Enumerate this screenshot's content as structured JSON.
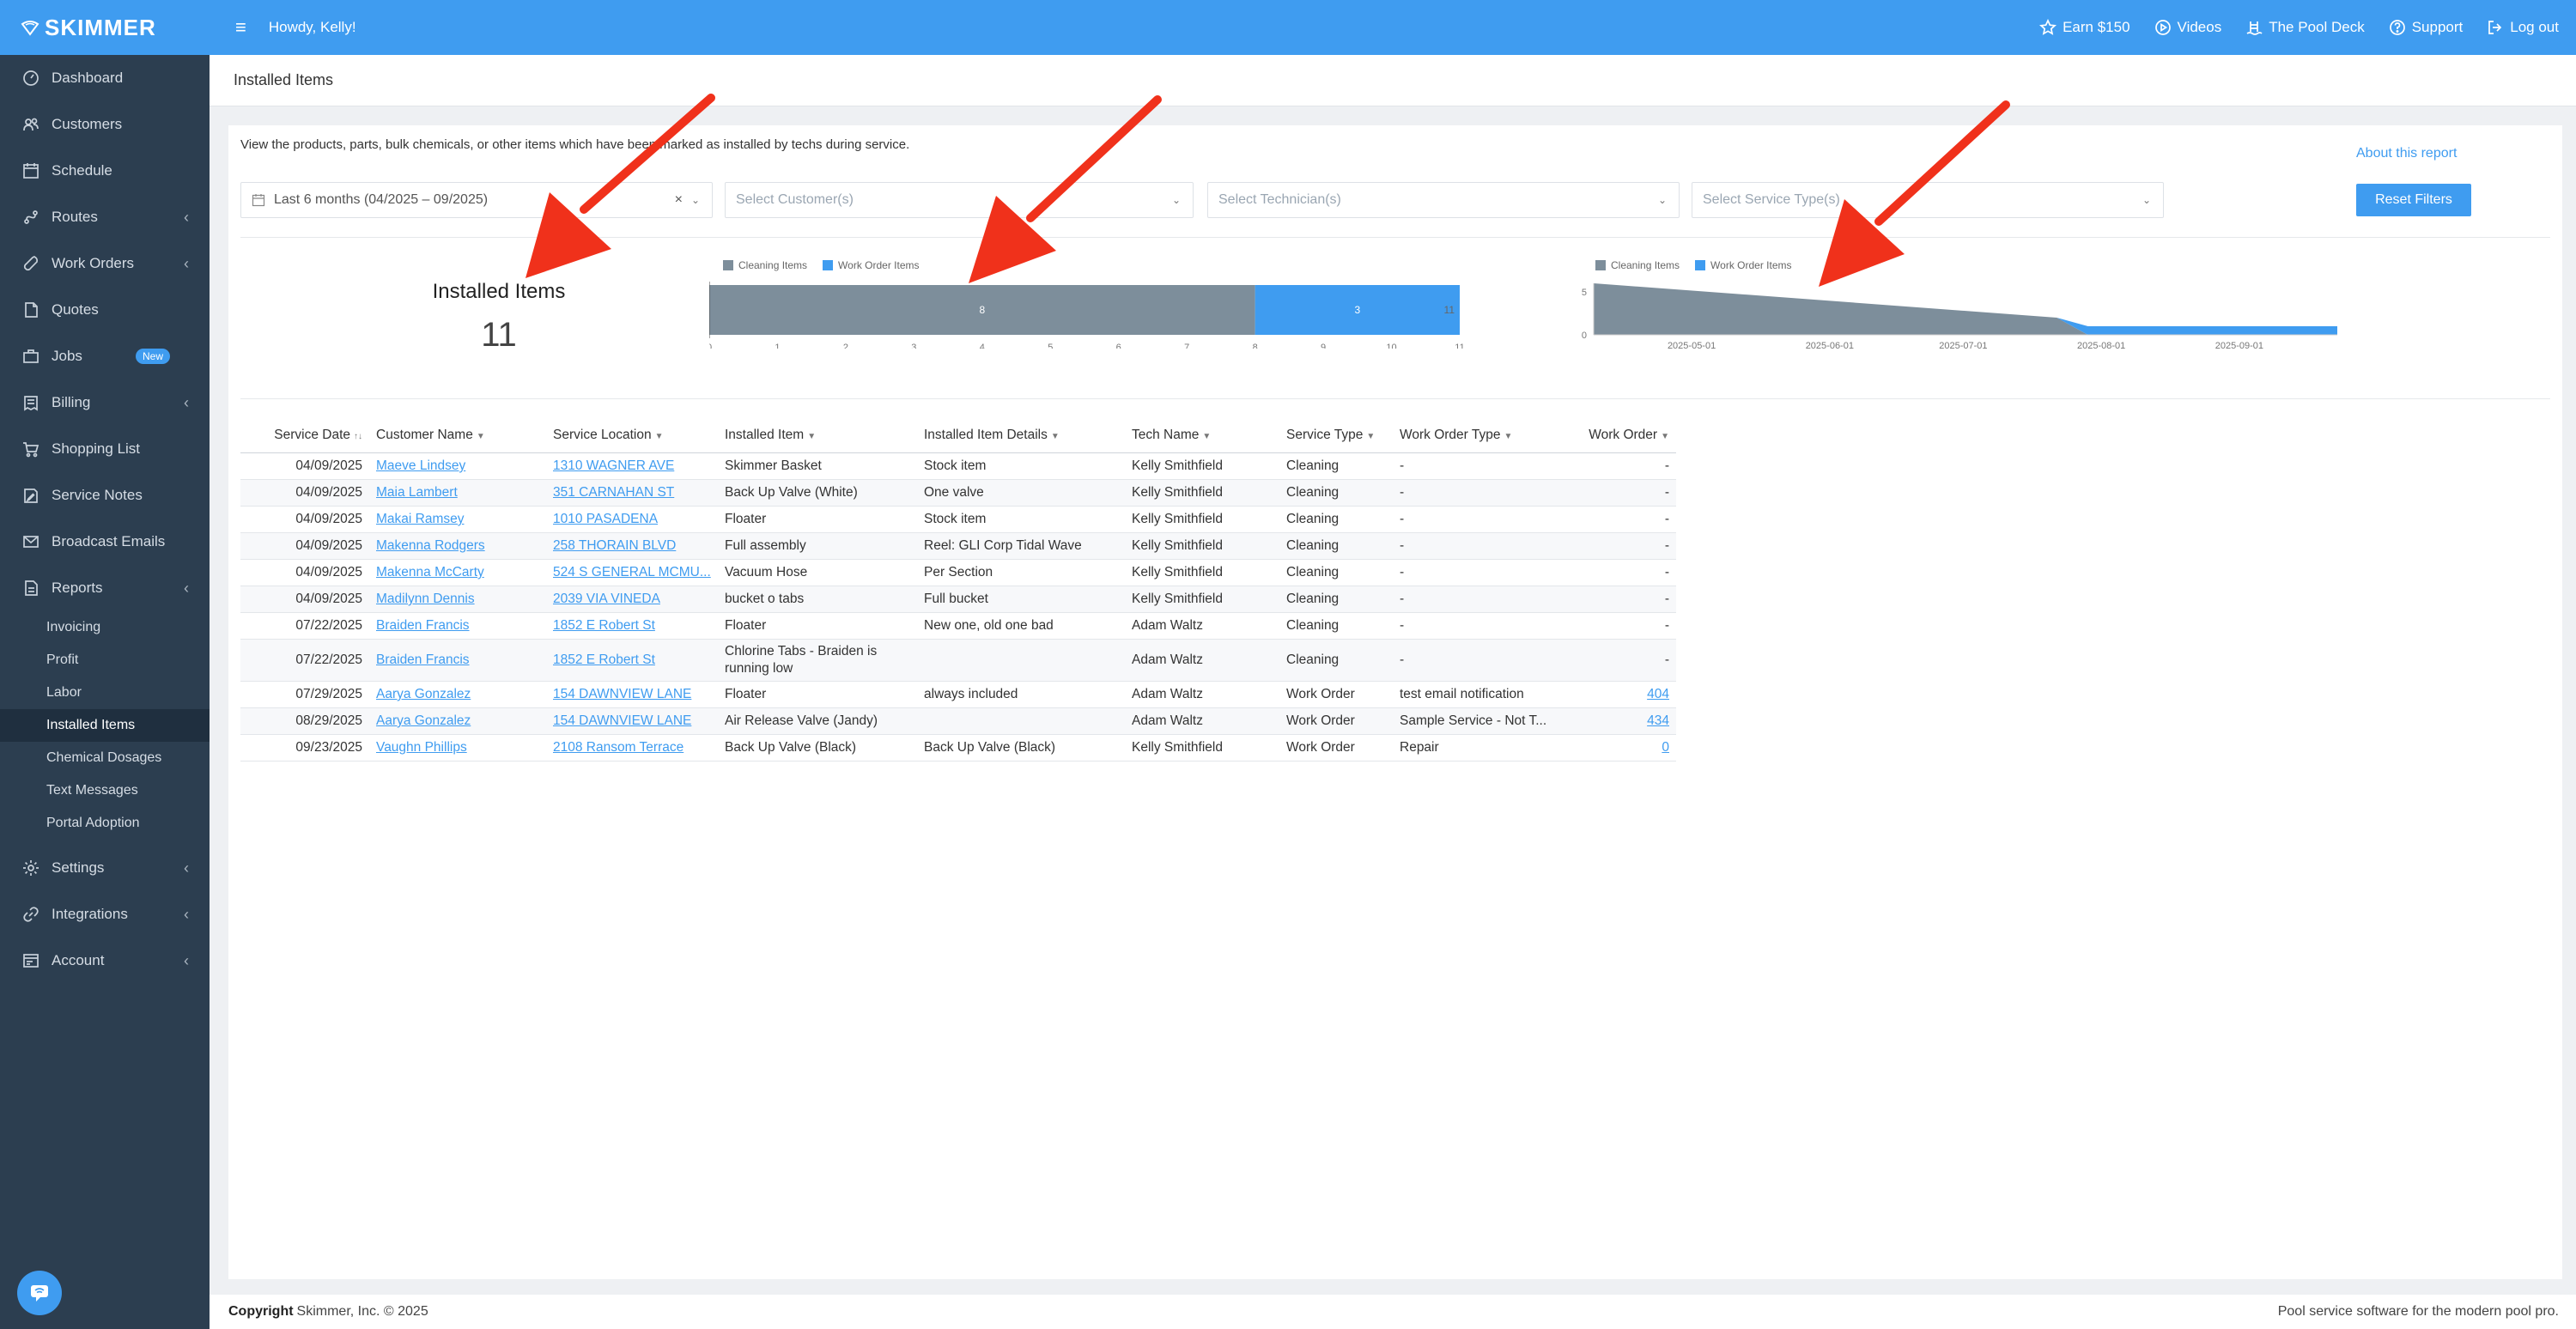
{
  "app": {
    "logo": "SKIMMER"
  },
  "topbar": {
    "greeting": "Howdy, Kelly!",
    "links": [
      "Earn $150",
      "Videos",
      "The Pool Deck",
      "Support",
      "Log out"
    ]
  },
  "sidebar": {
    "items": [
      {
        "label": "Dashboard",
        "icon": "dashboard-icon"
      },
      {
        "label": "Customers",
        "icon": "customers-icon"
      },
      {
        "label": "Schedule",
        "icon": "schedule-icon"
      },
      {
        "label": "Routes",
        "icon": "routes-icon"
      },
      {
        "label": "Work Orders",
        "icon": "wrench-icon"
      },
      {
        "label": "Quotes",
        "icon": "quotes-icon"
      },
      {
        "label": "Jobs",
        "icon": "jobs-icon",
        "badge": "New"
      },
      {
        "label": "Billing",
        "icon": "billing-icon"
      },
      {
        "label": "Shopping List",
        "icon": "cart-icon"
      },
      {
        "label": "Service Notes",
        "icon": "notes-icon"
      },
      {
        "label": "Broadcast Emails",
        "icon": "email-icon"
      },
      {
        "label": "Reports",
        "icon": "reports-icon"
      }
    ],
    "reports_sub": [
      "Invoicing",
      "Profit",
      "Labor",
      "Installed Items",
      "Chemical Dosages",
      "Text Messages",
      "Portal Adoption"
    ],
    "bottom_items": [
      {
        "label": "Settings",
        "icon": "gear-icon"
      },
      {
        "label": "Integrations",
        "icon": "link-icon"
      },
      {
        "label": "Account",
        "icon": "account-icon"
      }
    ]
  },
  "page": {
    "title": "Installed Items",
    "description": "View the products, parts, bulk chemicals, or other items which have been marked as installed by techs during service.",
    "about_link": "About this report",
    "reset_button": "Reset Filters"
  },
  "filters": {
    "date": "Last 6 months (04/2025 – 09/2025)",
    "customer_placeholder": "Select Customer(s)",
    "technician_placeholder": "Select Technician(s)",
    "service_type_placeholder": "Select Service Type(s)"
  },
  "kpi": {
    "title": "Installed Items",
    "value": "11"
  },
  "colors": {
    "cleaning": "#7d8e9b",
    "work_order": "#3f9cf0",
    "accent": "#3f9cf0",
    "sidebar": "#2c3e50",
    "arrow": "#f0311b"
  },
  "chart_data": [
    {
      "type": "bar",
      "orientation": "horizontal-stacked",
      "legend": [
        "Cleaning Items",
        "Work Order Items"
      ],
      "series": [
        {
          "name": "Cleaning Items",
          "values": [
            8
          ]
        },
        {
          "name": "Work Order Items",
          "values": [
            3
          ]
        }
      ],
      "total_label": "11",
      "xlim": [
        0,
        11
      ],
      "xticks": [
        "0",
        "1",
        "2",
        "3",
        "4",
        "5",
        "6",
        "7",
        "8",
        "9",
        "10",
        "11"
      ]
    },
    {
      "type": "area",
      "stacked": true,
      "legend": [
        "Cleaning Items",
        "Work Order Items"
      ],
      "x": [
        "2025-04-09",
        "2025-07-22",
        "2025-07-29",
        "2025-08-29",
        "2025-09-23"
      ],
      "series": [
        {
          "name": "Cleaning Items",
          "values": [
            6,
            2,
            0,
            0,
            0
          ]
        },
        {
          "name": "Work Order Items",
          "values": [
            0,
            0,
            1,
            1,
            1
          ]
        }
      ],
      "ylim": [
        0,
        6
      ],
      "yticks": [
        "0",
        "5"
      ],
      "xticks": [
        "2025-05-01",
        "2025-06-01",
        "2025-07-01",
        "2025-08-01",
        "2025-09-01"
      ]
    }
  ],
  "table": {
    "columns": [
      "Service Date",
      "Customer Name",
      "Service Location",
      "Installed Item",
      "Installed Item Details",
      "Tech Name",
      "Service Type",
      "Work Order Type",
      "Work Order"
    ],
    "rows": [
      [
        "04/09/2025",
        "Maeve Lindsey",
        "1310 WAGNER AVE",
        "Skimmer Basket",
        "Stock item",
        "Kelly Smithfield",
        "Cleaning",
        "-",
        "-"
      ],
      [
        "04/09/2025",
        "Maia Lambert",
        "351 CARNAHAN ST",
        "Back Up Valve (White)",
        "One valve",
        "Kelly Smithfield",
        "Cleaning",
        "-",
        "-"
      ],
      [
        "04/09/2025",
        "Makai Ramsey",
        "1010 PASADENA",
        "Floater",
        "Stock item",
        "Kelly Smithfield",
        "Cleaning",
        "-",
        "-"
      ],
      [
        "04/09/2025",
        "Makenna Rodgers",
        "258 THORAIN BLVD",
        "Full assembly",
        "Reel: GLI Corp Tidal Wave",
        "Kelly Smithfield",
        "Cleaning",
        "-",
        "-"
      ],
      [
        "04/09/2025",
        "Makenna McCarty",
        "524 S GENERAL MCMU...",
        "Vacuum Hose",
        "Per Section",
        "Kelly Smithfield",
        "Cleaning",
        "-",
        "-"
      ],
      [
        "04/09/2025",
        "Madilynn Dennis",
        "2039 VIA VINEDA",
        "bucket o tabs",
        "Full bucket",
        "Kelly Smithfield",
        "Cleaning",
        "-",
        "-"
      ],
      [
        "07/22/2025",
        "Braiden Francis",
        "1852 E Robert St",
        "Floater",
        "New one, old one bad",
        "Adam Waltz",
        "Cleaning",
        "-",
        "-"
      ],
      [
        "07/22/2025",
        "Braiden Francis",
        "1852 E Robert St",
        "Chlorine Tabs - Braiden is running low",
        "",
        "Adam Waltz",
        "Cleaning",
        "-",
        "-"
      ],
      [
        "07/29/2025",
        "Aarya Gonzalez",
        "154 DAWNVIEW LANE",
        "Floater",
        "always included",
        "Adam Waltz",
        "Work Order",
        "test email notification",
        "404"
      ],
      [
        "08/29/2025",
        "Aarya Gonzalez",
        "154 DAWNVIEW LANE",
        "Air Release Valve (Jandy)",
        "",
        "Adam Waltz",
        "Work Order",
        "Sample Service - Not T...",
        "434"
      ],
      [
        "09/23/2025",
        "Vaughn Phillips",
        "2108 Ransom Terrace",
        "Back Up Valve (Black)",
        "Back Up Valve (Black)",
        "Kelly Smithfield",
        "Work Order",
        "Repair",
        "0"
      ]
    ]
  },
  "footer": {
    "copyright_bold": "Copyright",
    "copyright_rest": "Skimmer, Inc. © 2025",
    "tagline": "Pool service software for the modern pool pro."
  }
}
